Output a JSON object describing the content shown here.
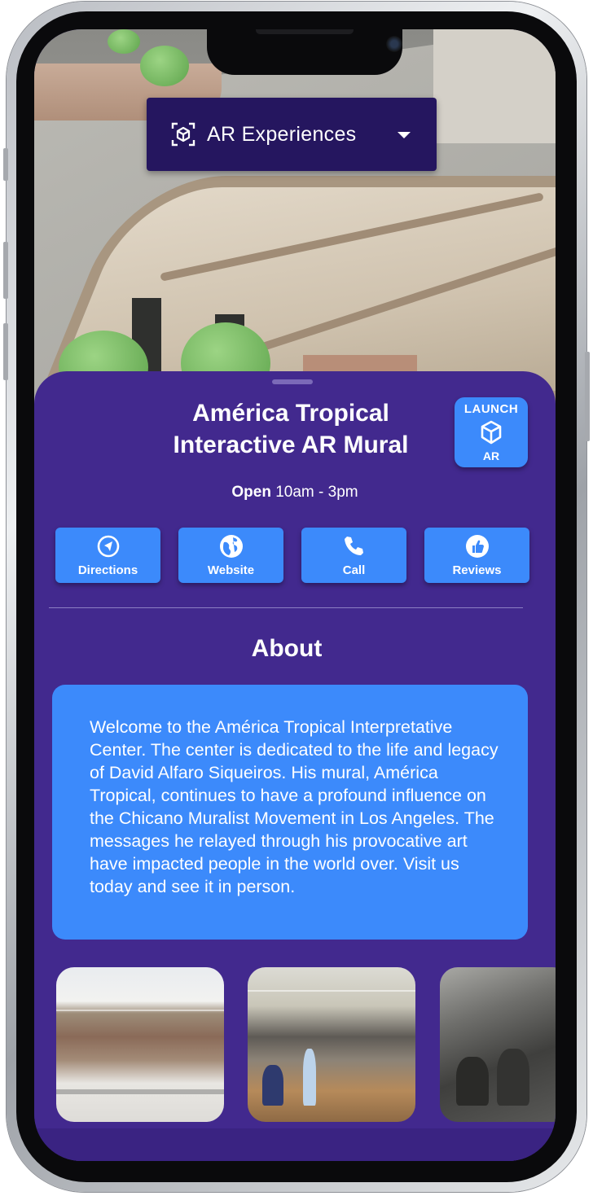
{
  "dropdown": {
    "label": "AR Experiences",
    "icon": "ar-scan-icon",
    "caret": "chevron-down-icon"
  },
  "location": {
    "title_line1": "América Tropical",
    "title_line2": "Interactive AR Mural",
    "hours_status": "Open",
    "hours_range": "10am - 3pm"
  },
  "launch": {
    "top": "LAUNCH",
    "bottom": "AR",
    "icon": "cube-icon"
  },
  "actions": [
    {
      "label": "Directions",
      "icon": "navigation-arrow-icon"
    },
    {
      "label": "Website",
      "icon": "globe-icon"
    },
    {
      "label": "Call",
      "icon": "phone-icon"
    },
    {
      "label": "Reviews",
      "icon": "thumbs-up-icon"
    }
  ],
  "about": {
    "heading": "About",
    "body": "Welcome to the América Tropical Interpretative Center. The center is dedicated to the life and legacy of David Alfaro Siqueiros. His mural, América Tropical, continues to have a profound influence on the Chicano Muralist Movement in Los Angeles. The messages he relayed through his provocative art have impacted people in the world over. Visit us today and see it in person."
  },
  "colors": {
    "sheet": "#42298e",
    "button": "#3c8afb",
    "dropdown": "#25165f"
  }
}
